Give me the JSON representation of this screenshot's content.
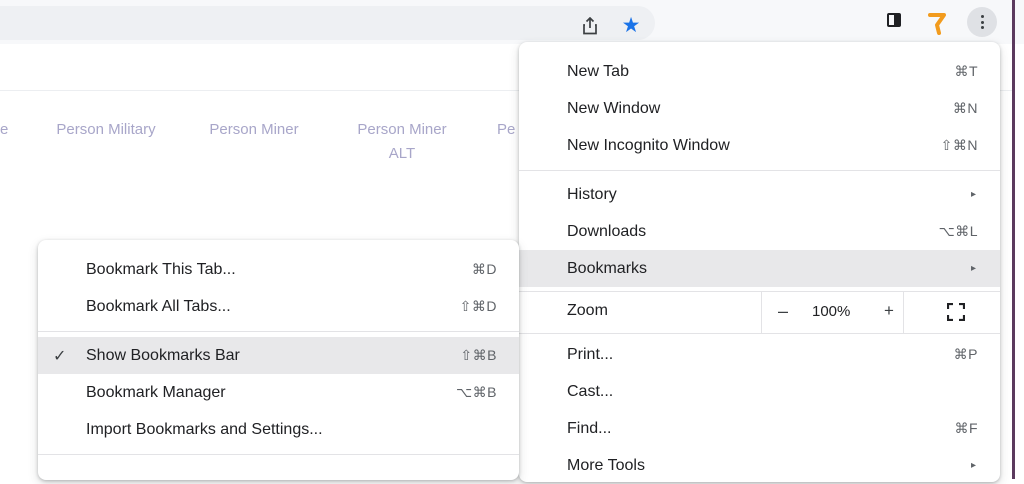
{
  "page": {
    "people": [
      {
        "line1": "Person Military",
        "line2": ""
      },
      {
        "line1": "Person Miner",
        "line2": ""
      },
      {
        "line1": "Person Miner",
        "line2": "ALT"
      }
    ],
    "left_cut": "e",
    "right_cut": "Pe"
  },
  "main_menu": {
    "items": [
      {
        "label": "New Tab",
        "shortcut": "⌘T"
      },
      {
        "label": "New Window",
        "shortcut": "⌘N"
      },
      {
        "label": "New Incognito Window",
        "shortcut": "⇧⌘N"
      },
      {
        "label": "History",
        "shortcut": "▸"
      },
      {
        "label": "Downloads",
        "shortcut": "⌥⌘L"
      },
      {
        "label": "Bookmarks",
        "shortcut": "▸"
      },
      {
        "label": "Print...",
        "shortcut": "⌘P"
      },
      {
        "label": "Cast...",
        "shortcut": ""
      },
      {
        "label": "Find...",
        "shortcut": "⌘F"
      },
      {
        "label": "More Tools",
        "shortcut": "▸"
      }
    ],
    "zoom": {
      "label": "Zoom",
      "minus": "–",
      "value": "100%",
      "plus": "+"
    }
  },
  "bookmarks_submenu": {
    "items": [
      {
        "label": "Bookmark This Tab...",
        "shortcut": "⌘D"
      },
      {
        "label": "Bookmark All Tabs...",
        "shortcut": "⇧⌘D"
      },
      {
        "label": "Show Bookmarks Bar",
        "shortcut": "⇧⌘B",
        "checked": true
      },
      {
        "label": "Bookmark Manager",
        "shortcut": "⌥⌘B"
      },
      {
        "label": "Import Bookmarks and Settings...",
        "shortcut": ""
      }
    ],
    "check_mark": "✓"
  },
  "colors": {
    "accent_star": "#1a73e8",
    "highlight": "#e8e8ea",
    "page_link_text": "#a8a6c9",
    "extension": "#f29b1d"
  },
  "icons": [
    "share-icon",
    "bookmark-star-icon",
    "side-panel-icon",
    "extension-icon",
    "more-menu-icon",
    "fullscreen-icon",
    "checkmark-icon",
    "submenu-arrow-icon"
  ]
}
